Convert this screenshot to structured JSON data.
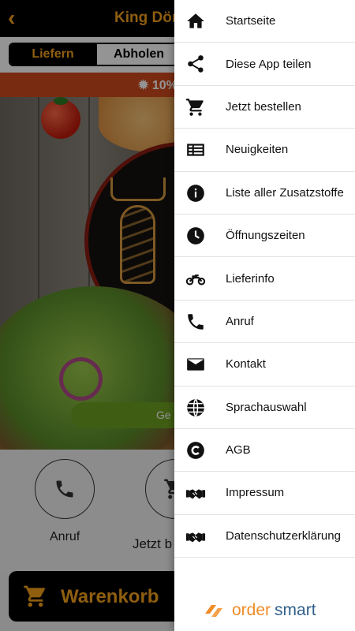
{
  "colors": {
    "accent": "#f7a21b",
    "promo": "#d04a1e",
    "drawer": "#ffffff"
  },
  "header": {
    "back_icon": "chevron-left-icon",
    "title": "King Döne"
  },
  "segment": {
    "deliver": "Liefern",
    "pickup": "Abholen"
  },
  "promo": {
    "icon": "badge-icon",
    "text": "10%"
  },
  "hero": {
    "button_text": "Ge"
  },
  "actions": {
    "call_label": "Anruf",
    "order_label": "Jetzt b"
  },
  "cart": {
    "label": "Warenkorb"
  },
  "menu": {
    "items": [
      {
        "label": "Startseite",
        "icon": "home-icon"
      },
      {
        "label": "Diese App teilen",
        "icon": "share-icon"
      },
      {
        "label": "Jetzt bestellen",
        "icon": "cart-icon"
      },
      {
        "label": "Neuigkeiten",
        "icon": "news-icon"
      },
      {
        "label": "Liste aller Zusatzstoffe",
        "icon": "info-icon"
      },
      {
        "label": "Öffnungszeiten",
        "icon": "clock-icon"
      },
      {
        "label": "Lieferinfo",
        "icon": "motorbike-icon"
      },
      {
        "label": "Anruf",
        "icon": "phone-icon"
      },
      {
        "label": "Kontakt",
        "icon": "mail-icon"
      },
      {
        "label": "Sprachauswahl",
        "icon": "globe-icon"
      },
      {
        "label": "AGB",
        "icon": "copyright-icon"
      },
      {
        "label": "Impressum",
        "icon": "handshake-icon"
      },
      {
        "label": "Datenschutzerklärung",
        "icon": "handshake-icon"
      }
    ]
  },
  "brand": {
    "part1": "order",
    "part2": "smart"
  }
}
